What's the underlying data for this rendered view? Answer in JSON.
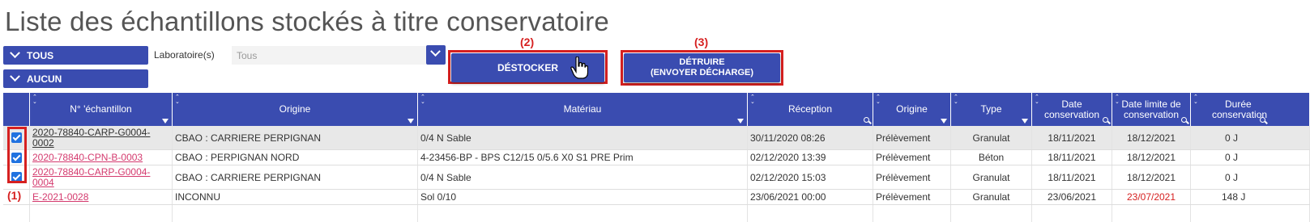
{
  "title": "Liste des échantillons stockés à titre conservatoire",
  "buttons": {
    "tous": "TOUS",
    "aucun": "AUCUN",
    "destocker": "DÉSTOCKER",
    "detruire_line1": "DÉTRUIRE",
    "detruire_line2": "(ENVOYER DÉCHARGE)"
  },
  "filter": {
    "label": "Laboratoire(s)",
    "value": "Tous"
  },
  "annotations": {
    "step1": "(1)",
    "step2": "(2)",
    "step3": "(3)"
  },
  "columns": {
    "echantillon": "N° 'échantillon",
    "origine": "Origine",
    "materiau": "Matériau",
    "reception": "Réception",
    "origine2": "Origine",
    "type": "Type",
    "date_conservation_1": "Date",
    "date_conservation_2": "conservation",
    "date_limite_1": "Date limite de",
    "date_limite_2": "conservation",
    "duree_1": "Durée",
    "duree_2": "conservation"
  },
  "rows": [
    {
      "checked": true,
      "id_line1": "2020-78840-CARP-G0004-",
      "id_line2": "0002",
      "origine": "CBAO : CARRIERE PERPIGNAN",
      "materiau": "0/4 N Sable",
      "reception": "30/11/2020 08:26",
      "origine2": "Prélèvement",
      "type": "Granulat",
      "date_conservation": "18/11/2021",
      "date_limite": "18/12/2021",
      "duree": "0 J"
    },
    {
      "checked": true,
      "id_line1": "2020-78840-CPN-B-0003",
      "id_line2": "",
      "origine": "CBAO : PERPIGNAN NORD",
      "materiau": "4-23456-BP - BPS C12/15 0/5.6 X0 S1 PRE Prim",
      "reception": "02/12/2020 13:39",
      "origine2": "Prélèvement",
      "type": "Béton",
      "date_conservation": "18/11/2021",
      "date_limite": "18/12/2021",
      "duree": "0 J"
    },
    {
      "checked": true,
      "id_line1": "2020-78840-CARP-G0004-",
      "id_line2": "0004",
      "origine": "CBAO : CARRIERE PERPIGNAN",
      "materiau": "0/4 N Sable",
      "reception": "02/12/2020 15:03",
      "origine2": "Prélèvement",
      "type": "Granulat",
      "date_conservation": "18/11/2021",
      "date_limite": "18/12/2021",
      "duree": "0 J"
    },
    {
      "checked": false,
      "id_line1": "E-2021-0028",
      "id_line2": "",
      "origine": "INCONNU",
      "materiau": "Sol 0/10",
      "reception": "23/06/2021 00:00",
      "origine2": "Prélèvement",
      "type": "Granulat",
      "date_conservation": "23/06/2021",
      "date_limite": "23/07/2021",
      "duree": "148 J"
    }
  ],
  "colors": {
    "primary": "#3a4cb0",
    "annotation_red": "#d62020",
    "link_pink": "#d43a6e",
    "checkbox_blue": "#1f72e0"
  }
}
